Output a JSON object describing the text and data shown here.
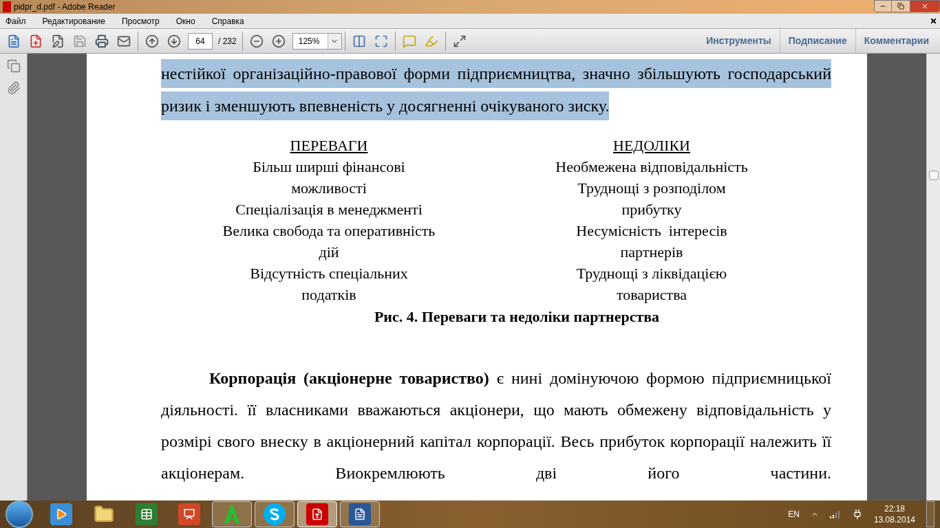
{
  "window": {
    "title": "pidpr_d.pdf - Adobe Reader"
  },
  "menu": [
    "Файл",
    "Редактирование",
    "Просмотр",
    "Окно",
    "Справка"
  ],
  "toolbar": {
    "page": "64",
    "page_total": "/ 232",
    "zoom": "125%"
  },
  "panels": [
    "Инструменты",
    "Подписание",
    "Комментарии"
  ],
  "document": {
    "highlighted_paragraph": {
      "text": "нестійкої організаційно-правової форми підприємництва, значно збільшують господарський ризик і зменшують впевненість у досягненні очікуваного зиску.",
      "highlighted": true
    },
    "figure": {
      "columns": [
        {
          "heading": "ПЕРЕВАГИ",
          "lines": [
            "Більш ширші фінансові",
            "можливості",
            "Спеціалізація в менеджменті",
            "Велика свобода та оперативність",
            "дій",
            "Відсутність спеціальних",
            "податків"
          ]
        },
        {
          "heading": "НЕДОЛІКИ",
          "lines": [
            "Необмежена відповідальність",
            "Труднощі з розподілом",
            "прибутку",
            "Несумісність  інтересів",
            "партнерів",
            "Труднощі з ліквідацією",
            "товариства"
          ]
        }
      ],
      "caption": "Рис. 4. Переваги та недоліки партнерства"
    },
    "paragraph": "**Корпорація (акціонерне товариство)** є нині домінуючою формою підприємницької діяльності. її власниками вважаються акціонери, що мають обмежену відповідальність у розмірі свого внеску в акціонерний капітал корпорації. Весь прибуток корпорації належить її акціонерам. Виокремлюють дві його частини."
  },
  "taskbar": {
    "apps": [
      {
        "kind": "player",
        "running": false
      },
      {
        "kind": "folder",
        "running": false
      },
      {
        "kind": "excel",
        "running": false
      },
      {
        "kind": "slides",
        "running": false
      },
      {
        "kind": "letter",
        "running": true
      },
      {
        "kind": "skype",
        "running": true
      },
      {
        "kind": "pdf",
        "running": true,
        "selected": true
      },
      {
        "kind": "word",
        "running": true
      }
    ],
    "language": "EN",
    "time": "22:18",
    "date": "13.08.2014"
  }
}
